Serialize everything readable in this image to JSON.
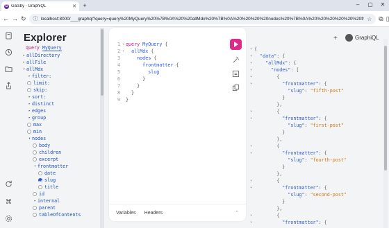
{
  "browser": {
    "tab_title": "Gatsby - GraphiQL",
    "tab_favicon": "G",
    "new_tab": "+",
    "url": "localhost:8000/___graphql?query=query%20MyQuery%20%7B%0A%20%20allMdx%20%7B%0A%20%20%20%20nodes%20%7B%0A%20%20%20%20%20%20fr",
    "avatar": "⋮"
  },
  "explorer": {
    "title": "Explorer",
    "query_keyword": "query",
    "query_name": "MyQuery",
    "items": [
      {
        "label": "allDirectory",
        "kind": "arrow",
        "indent": 0,
        "open": false
      },
      {
        "label": "allFile",
        "kind": "arrow",
        "indent": 0,
        "open": false
      },
      {
        "label": "allMdx",
        "kind": "arrow",
        "indent": 0,
        "open": true
      },
      {
        "label": "filter:",
        "kind": "arrow",
        "indent": 1,
        "open": false
      },
      {
        "label": "limit:",
        "kind": "check",
        "indent": 1,
        "checked": false
      },
      {
        "label": "skip:",
        "kind": "check",
        "indent": 1,
        "checked": false
      },
      {
        "label": "sort:",
        "kind": "arrow",
        "indent": 1,
        "open": false
      },
      {
        "label": "distinct",
        "kind": "arrow",
        "indent": 1,
        "open": false
      },
      {
        "label": "edges",
        "kind": "arrow",
        "indent": 1,
        "open": false
      },
      {
        "label": "group",
        "kind": "arrow",
        "indent": 1,
        "open": false
      },
      {
        "label": "max",
        "kind": "check",
        "indent": 1,
        "checked": false
      },
      {
        "label": "min",
        "kind": "check",
        "indent": 1,
        "checked": false
      },
      {
        "label": "nodes",
        "kind": "arrow",
        "indent": 1,
        "open": true
      },
      {
        "label": "body",
        "kind": "check",
        "indent": 2,
        "checked": false
      },
      {
        "label": "children",
        "kind": "check",
        "indent": 2,
        "checked": false
      },
      {
        "label": "excerpt",
        "kind": "check",
        "indent": 2,
        "checked": false
      },
      {
        "label": "frontmatter",
        "kind": "arrow",
        "indent": 2,
        "open": true
      },
      {
        "label": "date",
        "kind": "check",
        "indent": 3,
        "checked": false
      },
      {
        "label": "slug",
        "kind": "check",
        "indent": 3,
        "checked": true
      },
      {
        "label": "title",
        "kind": "check",
        "indent": 3,
        "checked": false
      },
      {
        "label": "id",
        "kind": "check",
        "indent": 2,
        "checked": false
      },
      {
        "label": "internal",
        "kind": "arrow",
        "indent": 2,
        "open": false
      },
      {
        "label": "parent",
        "kind": "check",
        "indent": 2,
        "checked": false
      },
      {
        "label": "tableOfContents",
        "kind": "check",
        "indent": 2,
        "checked": false
      }
    ]
  },
  "editor": {
    "lines": [
      {
        "n": "1",
        "fold": "▾",
        "parts": [
          [
            "k",
            "query"
          ],
          [
            "p",
            " "
          ],
          [
            "n",
            "MyQuery"
          ],
          [
            "p",
            " {"
          ]
        ]
      },
      {
        "n": "2",
        "fold": "▾",
        "parts": [
          [
            "p",
            "  "
          ],
          [
            "f",
            "allMdx"
          ],
          [
            "p",
            " {"
          ]
        ]
      },
      {
        "n": "3",
        "fold": "",
        "parts": [
          [
            "p",
            "    "
          ],
          [
            "f",
            "nodes"
          ],
          [
            "p",
            " {"
          ]
        ]
      },
      {
        "n": "4",
        "fold": "",
        "parts": [
          [
            "p",
            "      "
          ],
          [
            "f",
            "frontmatter"
          ],
          [
            "p",
            " {"
          ]
        ]
      },
      {
        "n": "5",
        "fold": "",
        "parts": [
          [
            "p",
            "        "
          ],
          [
            "f",
            "slug"
          ]
        ]
      },
      {
        "n": "6",
        "fold": "",
        "parts": [
          [
            "p",
            "      }"
          ]
        ]
      },
      {
        "n": "7",
        "fold": "",
        "parts": [
          [
            "p",
            "    }"
          ]
        ]
      },
      {
        "n": "8",
        "fold": "",
        "parts": [
          [
            "p",
            "  }"
          ]
        ]
      },
      {
        "n": "9",
        "fold": "",
        "parts": [
          [
            "p",
            "}"
          ]
        ]
      }
    ],
    "footer_variables": "Variables",
    "footer_headers": "Headers"
  },
  "result_header": {
    "add": "+",
    "brand": "GraphiQL"
  },
  "result": {
    "lines": [
      {
        "fold": "▾",
        "parts": [
          [
            "pn",
            "{"
          ]
        ]
      },
      {
        "fold": "▾",
        "parts": [
          [
            "pn",
            "  "
          ],
          [
            "key",
            "\"data\""
          ],
          [
            "pn",
            ": {"
          ]
        ]
      },
      {
        "fold": "▾",
        "parts": [
          [
            "pn",
            "    "
          ],
          [
            "key",
            "\"allMdx\""
          ],
          [
            "pn",
            ": {"
          ]
        ]
      },
      {
        "fold": "▾",
        "parts": [
          [
            "pn",
            "      "
          ],
          [
            "key",
            "\"nodes\""
          ],
          [
            "pn",
            ": ["
          ]
        ]
      },
      {
        "fold": "▾",
        "parts": [
          [
            "pn",
            "        {"
          ]
        ]
      },
      {
        "fold": "▾",
        "parts": [
          [
            "pn",
            "          "
          ],
          [
            "key",
            "\"frontmatter\""
          ],
          [
            "pn",
            ": {"
          ]
        ]
      },
      {
        "fold": "",
        "parts": [
          [
            "pn",
            "            "
          ],
          [
            "key",
            "\"slug\""
          ],
          [
            "pn",
            ": "
          ],
          [
            "str",
            "\"fifth-post\""
          ]
        ]
      },
      {
        "fold": "",
        "parts": [
          [
            "pn",
            "          }"
          ]
        ]
      },
      {
        "fold": "",
        "parts": [
          [
            "pn",
            "        },"
          ]
        ]
      },
      {
        "fold": "▾",
        "parts": [
          [
            "pn",
            "        {"
          ]
        ]
      },
      {
        "fold": "▾",
        "parts": [
          [
            "pn",
            "          "
          ],
          [
            "key",
            "\"frontmatter\""
          ],
          [
            "pn",
            ": {"
          ]
        ]
      },
      {
        "fold": "",
        "parts": [
          [
            "pn",
            "            "
          ],
          [
            "key",
            "\"slug\""
          ],
          [
            "pn",
            ": "
          ],
          [
            "str",
            "\"first-post\""
          ]
        ]
      },
      {
        "fold": "",
        "parts": [
          [
            "pn",
            "          }"
          ]
        ]
      },
      {
        "fold": "",
        "parts": [
          [
            "pn",
            "        },"
          ]
        ]
      },
      {
        "fold": "▾",
        "parts": [
          [
            "pn",
            "        {"
          ]
        ]
      },
      {
        "fold": "▾",
        "parts": [
          [
            "pn",
            "          "
          ],
          [
            "key",
            "\"frontmatter\""
          ],
          [
            "pn",
            ": {"
          ]
        ]
      },
      {
        "fold": "",
        "parts": [
          [
            "pn",
            "            "
          ],
          [
            "key",
            "\"slug\""
          ],
          [
            "pn",
            ": "
          ],
          [
            "str",
            "\"fourth-post\""
          ]
        ]
      },
      {
        "fold": "",
        "parts": [
          [
            "pn",
            "          }"
          ]
        ]
      },
      {
        "fold": "",
        "parts": [
          [
            "pn",
            "        },"
          ]
        ]
      },
      {
        "fold": "▾",
        "parts": [
          [
            "pn",
            "        {"
          ]
        ]
      },
      {
        "fold": "▾",
        "parts": [
          [
            "pn",
            "          "
          ],
          [
            "key",
            "\"frontmatter\""
          ],
          [
            "pn",
            ": {"
          ]
        ]
      },
      {
        "fold": "",
        "parts": [
          [
            "pn",
            "            "
          ],
          [
            "key",
            "\"slug\""
          ],
          [
            "pn",
            ": "
          ],
          [
            "str",
            "\"second-post\""
          ]
        ]
      },
      {
        "fold": "",
        "parts": [
          [
            "pn",
            "          }"
          ]
        ]
      },
      {
        "fold": "",
        "parts": [
          [
            "pn",
            "        },"
          ]
        ]
      },
      {
        "fold": "▾",
        "parts": [
          [
            "pn",
            "        {"
          ]
        ]
      },
      {
        "fold": "▾",
        "parts": [
          [
            "pn",
            "          "
          ],
          [
            "key",
            "\"frontmatter\""
          ],
          [
            "pn",
            ": {"
          ]
        ]
      }
    ]
  },
  "colors": {
    "accent": "#dd2b87",
    "keyword": "#b11a78",
    "field": "#2b58d8",
    "string": "#d1750a"
  }
}
